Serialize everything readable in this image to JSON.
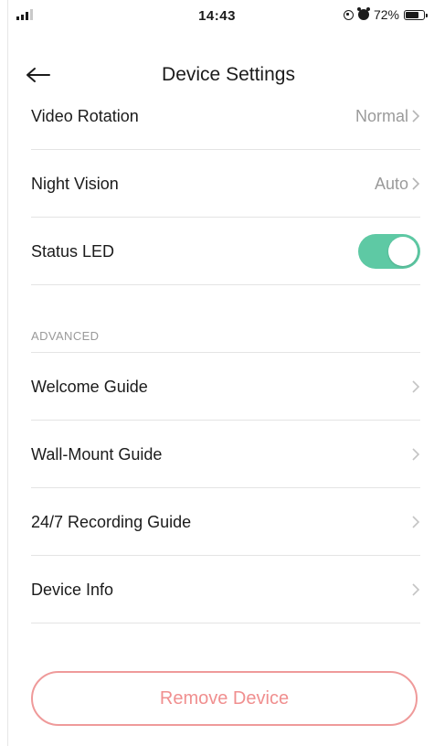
{
  "status_bar": {
    "time": "14:43",
    "battery": "72%",
    "battery_level": 0.72
  },
  "header": {
    "title": "Device Settings"
  },
  "settings": {
    "video_rotation": {
      "label": "Video Rotation",
      "value": "Normal"
    },
    "night_vision": {
      "label": "Night Vision",
      "value": "Auto"
    },
    "status_led": {
      "label": "Status LED",
      "enabled": true
    }
  },
  "advanced": {
    "section_label": "ADVANCED",
    "items": [
      {
        "label": "Welcome Guide"
      },
      {
        "label": "Wall-Mount Guide"
      },
      {
        "label": "24/7 Recording Guide"
      },
      {
        "label": "Device Info"
      }
    ]
  },
  "remove_button": {
    "label": "Remove Device"
  },
  "colors": {
    "toggle_on": "#5ec9a4",
    "remove_accent": "#f08f8f"
  }
}
